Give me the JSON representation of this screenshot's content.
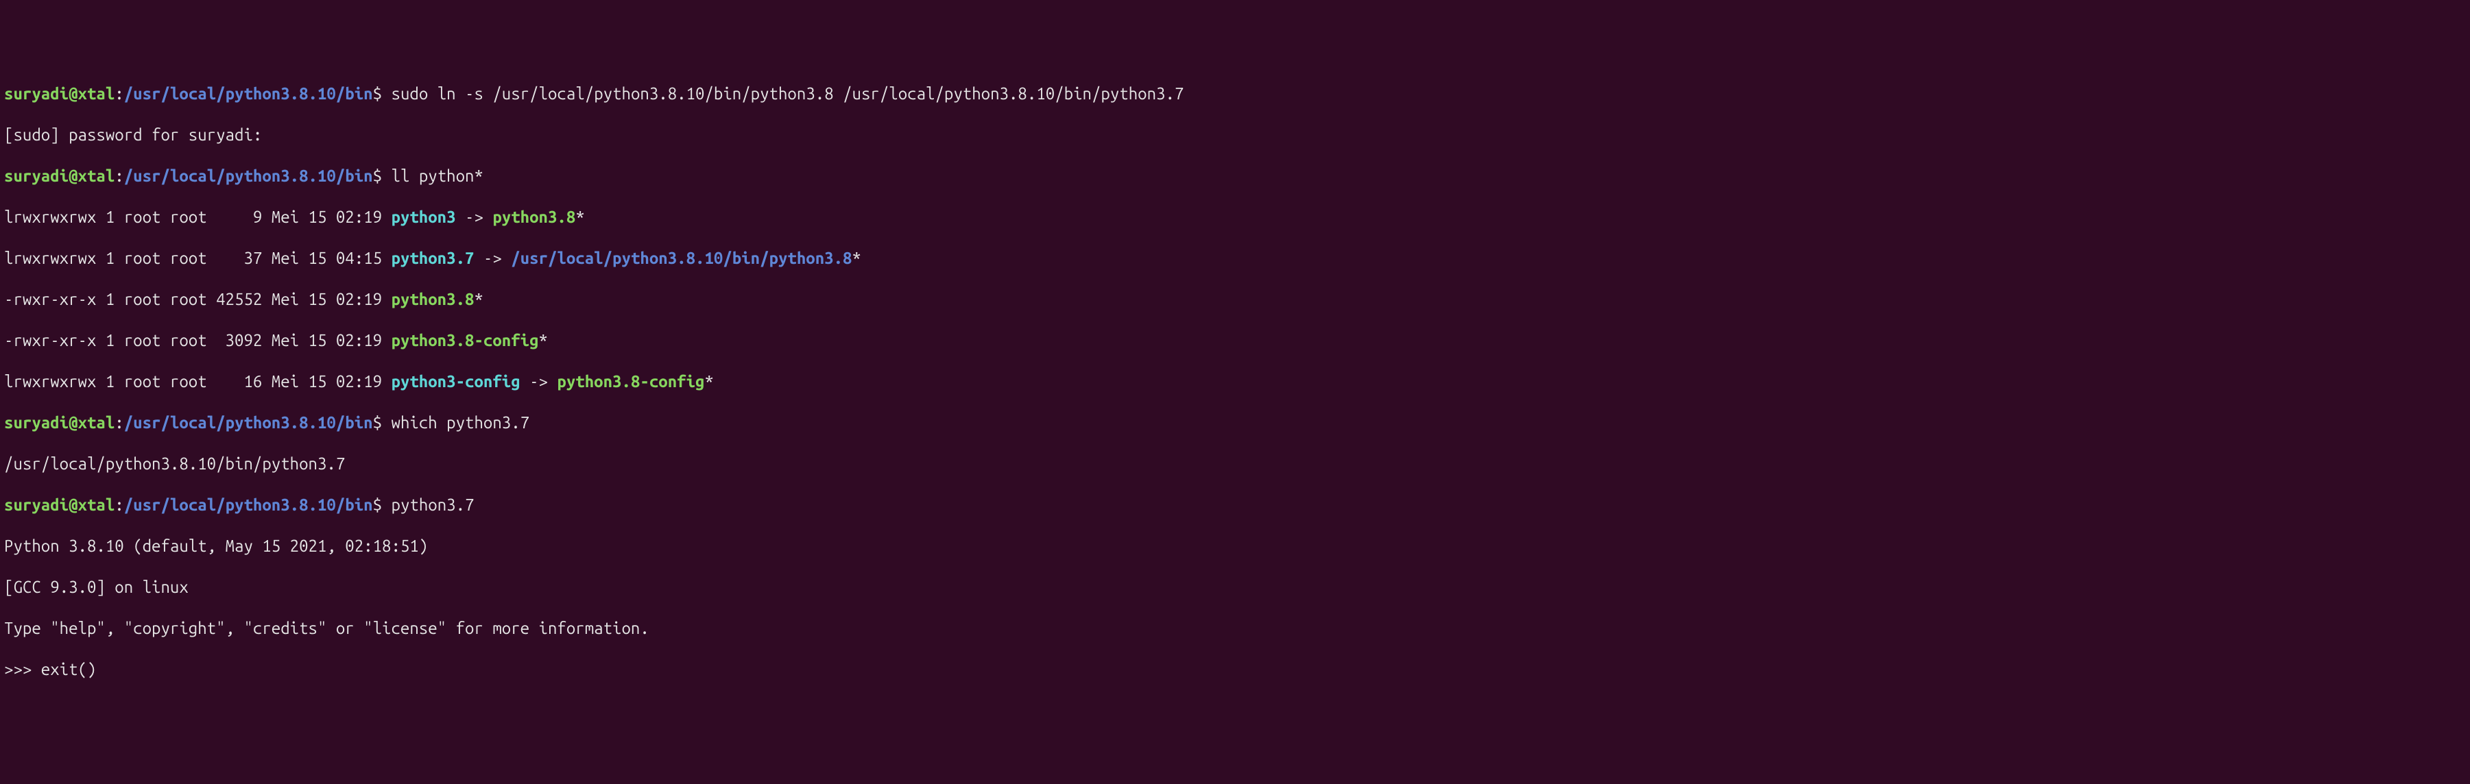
{
  "prompt": {
    "userhost": "suryadi@xtal",
    "colon": ":",
    "path": "/usr/local/python3.8.10/bin",
    "dollar": "$"
  },
  "lines": {
    "cmd1": " sudo ln -s /usr/local/python3.8.10/bin/python3.8 /usr/local/python3.8.10/bin/python3.7",
    "sudo_prompt": "[sudo] password for suryadi:",
    "cmd2": " ll python*",
    "ll1_perms": "lrwxrwxrwx 1 root root     9 Mei 15 02:19 ",
    "ll1_name": "python3",
    "ll1_arrow": " -> ",
    "ll1_target": "python3.8",
    "ll2_perms": "lrwxrwxrwx 1 root root    37 Mei 15 04:15 ",
    "ll2_name": "python3.7",
    "ll2_arrow": " -> ",
    "ll2_target": "/usr/local/python3.8.10/bin/python3.8",
    "ll3_perms": "-rwxr-xr-x 1 root root 42552 Mei 15 02:19 ",
    "ll3_name": "python3.8",
    "ll4_perms": "-rwxr-xr-x 1 root root  3092 Mei 15 02:19 ",
    "ll4_name": "python3.8-config",
    "ll5_perms": "lrwxrwxrwx 1 root root    16 Mei 15 02:19 ",
    "ll5_name": "python3-config",
    "ll5_arrow": " -> ",
    "ll5_target": "python3.8-config",
    "cmd3": " which python3.7",
    "which_out": "/usr/local/python3.8.10/bin/python3.7",
    "cmd4": " python3.7",
    "py_version": "Python 3.8.10 (default, May 15 2021, 02:18:51)",
    "py_gcc": "[GCC 9.3.0] on linux",
    "py_help": "Type \"help\", \"copyright\", \"credits\" or \"license\" for more information.",
    "py_prompt": ">>> exit()",
    "star": "*"
  }
}
